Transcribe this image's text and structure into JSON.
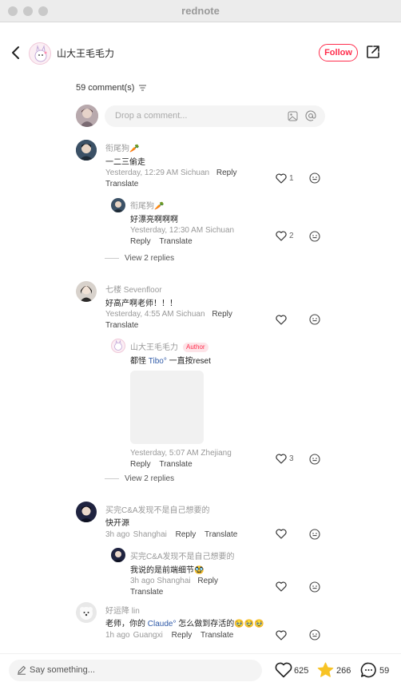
{
  "window": {
    "title": "rednote"
  },
  "header": {
    "author_name": "山大王毛毛力",
    "follow_label": "Follow"
  },
  "comments_section": {
    "count_label": "59 comment(s)",
    "input_placeholder": "Drop a comment..."
  },
  "threads": [
    {
      "user": "衔尾狗🥕",
      "text": "一二三偷走",
      "time": "Yesterday, 12:29 AM",
      "location": "Sichuan",
      "reply_label": "Reply",
      "translate_label": "Translate",
      "likes": "1",
      "reply": {
        "user": "衔尾狗🥕",
        "text": "好漂亮啊啊啊",
        "time": "Yesterday, 12:30 AM",
        "location": "Sichuan",
        "reply_label": "Reply",
        "translate_label": "Translate",
        "likes": "2"
      },
      "view_more": "View 2 replies"
    },
    {
      "user": "七楼 Sevenfloor",
      "text": "好高产啊老师！！！",
      "time": "Yesterday, 4:55 AM",
      "location": "Sichuan",
      "reply_label": "Reply",
      "translate_label": "Translate",
      "likes": "",
      "reply": {
        "user": "山大王毛毛力",
        "author_tag": "Author",
        "text_before": "都怪 ",
        "mention": "Tibo°",
        "text_after": " 一直按reset",
        "time": "Yesterday, 5:07 AM",
        "location": "Zhejiang",
        "reply_label": "Reply",
        "translate_label": "Translate",
        "likes": "3"
      },
      "view_more": "View 2 replies"
    },
    {
      "user": "买完C&A发现不是自己想要的",
      "text": "快开源",
      "time": "3h ago",
      "location": "Shanghai",
      "reply_label": "Reply",
      "translate_label": "Translate",
      "likes": "",
      "reply": {
        "user": "买完C&A发现不是自己想要的",
        "text": "我说的是前端细节🥸",
        "time": "3h ago",
        "location": "Shanghai",
        "reply_label": "Reply",
        "translate_label": "Translate",
        "likes": ""
      }
    },
    {
      "user": "好运降 lin",
      "text_before": "老师，你的 ",
      "mention": "Claude°",
      "text_after": " 怎么做到存活的🥹🥹🥹",
      "time": "1h ago",
      "location": "Guangxi",
      "reply_label": "Reply",
      "translate_label": "Translate",
      "likes": ""
    }
  ],
  "bottom_bar": {
    "input_placeholder": "Say something...",
    "likes": "625",
    "collects": "266",
    "comments": "59"
  },
  "colors": {
    "accent": "#ff2e4d",
    "mention": "#2f5aa8",
    "star": "#f7c325"
  }
}
